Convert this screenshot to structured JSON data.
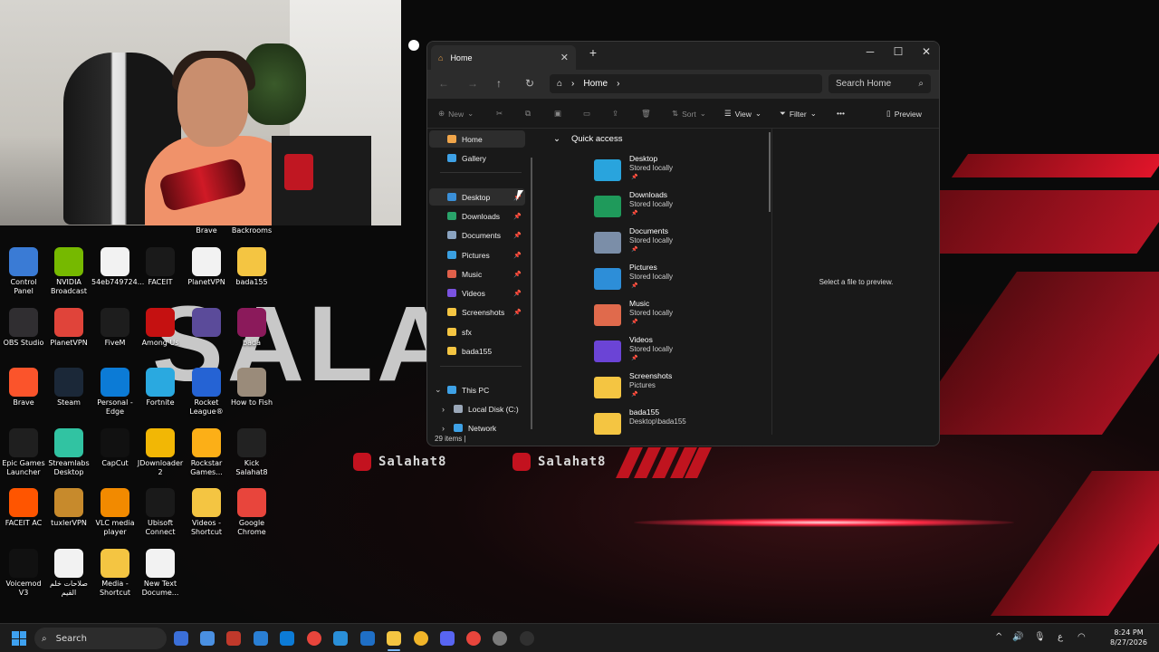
{
  "wallpaper": {
    "big_text": "SALAH",
    "handle": "Salahat8",
    "accent_color": "#c3121f"
  },
  "desktop": {
    "top_labels": [
      "Brave",
      "Backrooms"
    ],
    "icons": [
      {
        "label": "Control Panel",
        "icon": "control-panel-icon",
        "color": "#3a7bd5"
      },
      {
        "label": "NVIDIA Broadcast",
        "icon": "nvidia-icon",
        "color": "#76b900"
      },
      {
        "label": "54eb749724...",
        "icon": "file-icon",
        "color": "#f2f2f2"
      },
      {
        "label": "FACEIT",
        "icon": "faceit-icon",
        "color": "#1a1a1a"
      },
      {
        "label": "PlanetVPN",
        "icon": "file-icon",
        "color": "#f2f2f2"
      },
      {
        "label": "bada155",
        "icon": "folder-icon",
        "color": "#f4c542"
      },
      {
        "label": "OBS Studio",
        "icon": "obs-icon",
        "color": "#302e31"
      },
      {
        "label": "PlanetVPN",
        "icon": "planetvpn-icon",
        "color": "#e0443a"
      },
      {
        "label": "FiveM",
        "icon": "fivem-icon",
        "color": "#1d1d1d"
      },
      {
        "label": "Among Us",
        "icon": "amongus-icon",
        "color": "#c51111"
      },
      {
        "label": "",
        "icon": "launcher-icon",
        "color": "#5b4b9a"
      },
      {
        "label": "bada",
        "icon": "winrar-icon",
        "color": "#8b1a5b"
      },
      {
        "label": "Brave",
        "icon": "brave-icon",
        "color": "#fb542b"
      },
      {
        "label": "Steam",
        "icon": "steam-icon",
        "color": "#1b2838"
      },
      {
        "label": "Personal - Edge",
        "icon": "edge-icon",
        "color": "#0c7bd6"
      },
      {
        "label": "Fortnite",
        "icon": "fortnite-icon",
        "color": "#2aa9e0"
      },
      {
        "label": "Rocket League®",
        "icon": "rocket-league-icon",
        "color": "#2563d4"
      },
      {
        "label": "How to Fish",
        "icon": "game-icon",
        "color": "#9a8b7a"
      },
      {
        "label": "Epic Games Launcher",
        "icon": "epic-icon",
        "color": "#1f1f1f"
      },
      {
        "label": "Streamlabs Desktop",
        "icon": "streamlabs-icon",
        "color": "#31c3a2"
      },
      {
        "label": "CapCut",
        "icon": "capcut-icon",
        "color": "#111111"
      },
      {
        "label": "JDownloader 2",
        "icon": "jdownloader-icon",
        "color": "#f2b705"
      },
      {
        "label": "Rockstar Games...",
        "icon": "rockstar-icon",
        "color": "#fcaf17"
      },
      {
        "label": "Kick Salahat8",
        "icon": "kick-icon",
        "color": "#222222"
      },
      {
        "label": "FACEIT AC",
        "icon": "faceit-ac-icon",
        "color": "#ff5500"
      },
      {
        "label": "tuxlerVPN",
        "icon": "tuxler-icon",
        "color": "#c78a2c"
      },
      {
        "label": "VLC media player",
        "icon": "vlc-icon",
        "color": "#f28a00"
      },
      {
        "label": "Ubisoft Connect",
        "icon": "ubisoft-icon",
        "color": "#1a1a1a"
      },
      {
        "label": "Videos - Shortcut",
        "icon": "folder-icon",
        "color": "#f4c542"
      },
      {
        "label": "Google Chrome",
        "icon": "chrome-icon",
        "color": "#e8453c"
      },
      {
        "label": "Voicemod V3",
        "icon": "voicemod-icon",
        "color": "#111111"
      },
      {
        "label": "صلاحات خلم القيم",
        "icon": "file-icon",
        "color": "#f2f2f2"
      },
      {
        "label": "Media - Shortcut",
        "icon": "folder-icon",
        "color": "#f4c542"
      },
      {
        "label": "New Text Docume...",
        "icon": "file-icon",
        "color": "#f2f2f2"
      }
    ]
  },
  "explorer": {
    "tab_title": "Home",
    "new_tab": "+",
    "window_controls": {
      "minimize": "─",
      "maximize": "☐",
      "close": "✕"
    },
    "nav": {
      "back": "←",
      "forward": "→",
      "up": "↑",
      "refresh": "↻"
    },
    "address": {
      "home_icon": "⌂",
      "sep": "›",
      "path": "Home"
    },
    "search_placeholder": "Search Home",
    "toolbar": {
      "new": "New",
      "sort": "Sort",
      "view": "View",
      "filter": "Filter",
      "more": "•••",
      "preview": "Preview"
    },
    "sidebar": [
      {
        "label": "Home",
        "icon": "home-icon",
        "color": "#f0a54a",
        "pinned": false,
        "selected": true
      },
      {
        "label": "Gallery",
        "icon": "gallery-icon",
        "color": "#3ea1e6",
        "pinned": false,
        "selected": false
      },
      {
        "label": "Desktop",
        "icon": "desktop-icon",
        "color": "#3a8fd8",
        "pinned": true,
        "selected": true
      },
      {
        "label": "Downloads",
        "icon": "downloads-icon",
        "color": "#29a36a",
        "pinned": true,
        "selected": false
      },
      {
        "label": "Documents",
        "icon": "documents-icon",
        "color": "#8aa3c0",
        "pinned": true,
        "selected": false
      },
      {
        "label": "Pictures",
        "icon": "pictures-icon",
        "color": "#3a9fe0",
        "pinned": true,
        "selected": false
      },
      {
        "label": "Music",
        "icon": "music-icon",
        "color": "#e0604a",
        "pinned": true,
        "selected": false
      },
      {
        "label": "Videos",
        "icon": "videos-icon",
        "color": "#7a52e0",
        "pinned": true,
        "selected": false
      },
      {
        "label": "Screenshots",
        "icon": "folder-icon",
        "color": "#f4c542",
        "pinned": true,
        "selected": false
      },
      {
        "label": "sfx",
        "icon": "folder-icon",
        "color": "#f4c542",
        "pinned": false,
        "selected": false
      },
      {
        "label": "bada155",
        "icon": "folder-icon",
        "color": "#f4c542",
        "pinned": false,
        "selected": false
      },
      {
        "label": "This PC",
        "icon": "this-pc-icon",
        "color": "#3ea1e6",
        "pinned": false,
        "selected": false
      },
      {
        "label": "Local Disk (C:)",
        "icon": "disk-icon",
        "color": "#9aa7b8",
        "pinned": false,
        "selected": false
      },
      {
        "label": "Network",
        "icon": "network-icon",
        "color": "#3ea1e6",
        "pinned": false,
        "selected": false
      }
    ],
    "pin_glyph": "📌",
    "chevron_open": "⌄",
    "chevron_closed": "›",
    "quick_access": {
      "title": "Quick access",
      "items": [
        {
          "name": "Desktop",
          "sub": "Stored locally",
          "pinned": true,
          "color": "#29a4dd"
        },
        {
          "name": "Downloads",
          "sub": "Stored locally",
          "pinned": true,
          "color": "#1f9a5b"
        },
        {
          "name": "Documents",
          "sub": "Stored locally",
          "pinned": true,
          "color": "#7b8ea8"
        },
        {
          "name": "Pictures",
          "sub": "Stored locally",
          "pinned": true,
          "color": "#2d8ed8"
        },
        {
          "name": "Music",
          "sub": "Stored locally",
          "pinned": true,
          "color": "#e06a4c"
        },
        {
          "name": "Videos",
          "sub": "Stored locally",
          "pinned": true,
          "color": "#6b44d6"
        },
        {
          "name": "Screenshots",
          "sub": "Pictures",
          "pinned": true,
          "color": "#f4c542"
        },
        {
          "name": "bada155",
          "sub": "Desktop\\bada155",
          "pinned": false,
          "color": "#f4c542"
        }
      ]
    },
    "preview_text": "Select a file to preview.",
    "status": "29 items  |"
  },
  "taskbar": {
    "search_label": "Search",
    "apps": [
      "widgets-icon",
      "copilot-icon",
      "news-icon",
      "store-icon",
      "edge-icon",
      "chrome-icon",
      "notepad-icon",
      "photos-icon",
      "file-explorer-icon",
      "discord-icon",
      "messenger-icon",
      "chrome-icon",
      "steam-icon",
      "obs-icon"
    ],
    "tray": {
      "chevron": "^",
      "volume": "🔊",
      "mic": "🎙",
      "lang": "ع"
    },
    "time": "8:24 PM",
    "date": "8/27/2026"
  }
}
